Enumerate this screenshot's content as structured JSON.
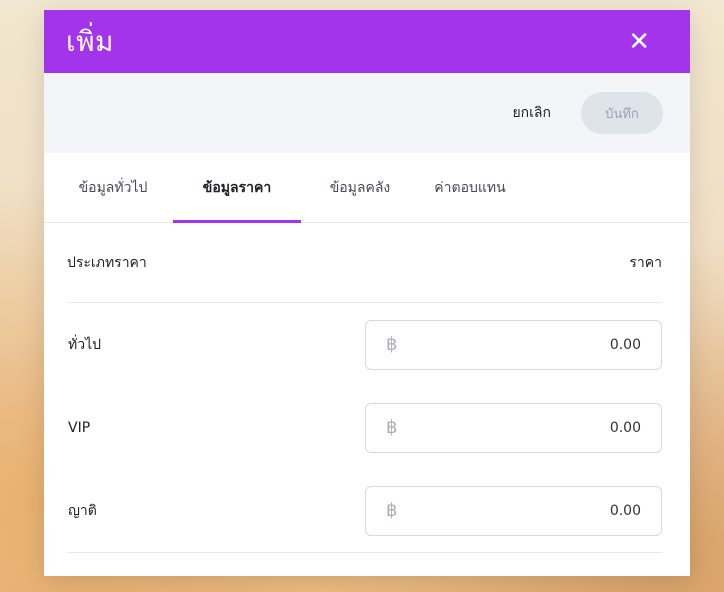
{
  "modal": {
    "title": "เพิ่ม",
    "close_glyph": "✕"
  },
  "actions": {
    "cancel_label": "ยกเลิก",
    "save_label": "บันทึก"
  },
  "tabs": [
    {
      "label": "ข้อมูลทั่วไป",
      "active": false
    },
    {
      "label": "ข้อมูลราคา",
      "active": true
    },
    {
      "label": "ข้อมูลคลัง",
      "active": false
    },
    {
      "label": "ค่าตอบแทน",
      "active": false
    }
  ],
  "price_table": {
    "col_type": "ประเภทราคา",
    "col_price": "ราคา",
    "currency_symbol": "฿",
    "rows": [
      {
        "label": "ทั่วไป",
        "value": "0.00"
      },
      {
        "label": "VIP",
        "value": "0.00"
      },
      {
        "label": "ญาติ",
        "value": "0.00"
      }
    ]
  },
  "colors": {
    "accent": "#a334eb",
    "save_disabled_bg": "#dfe3ea"
  }
}
